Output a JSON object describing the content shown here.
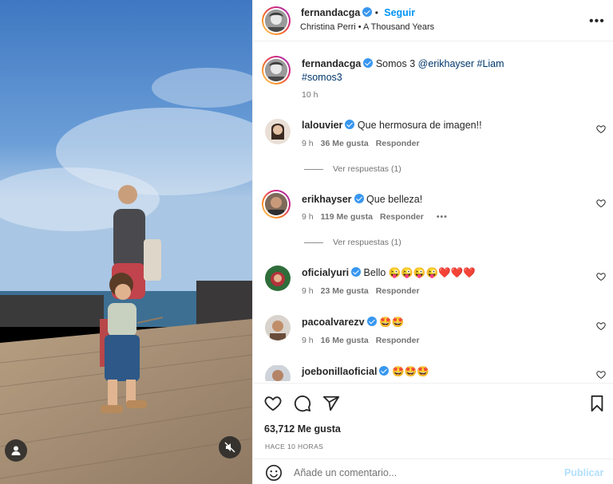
{
  "post": {
    "username": "fernandacga",
    "follow_label": "Seguir",
    "song": "Christina Perri • A Thousand Years",
    "caption_text": "Somos 3",
    "caption_mention": "@erikhayser",
    "caption_tag1": "#Liam",
    "caption_tag2": "#somos3",
    "caption_time": "10 h"
  },
  "comments": [
    {
      "user": "lalouvier",
      "text": "Que hermosura de imagen!!",
      "time": "9 h",
      "likes": "36 Me gusta",
      "reply": "Responder",
      "view_replies": "Ver respuestas (1)"
    },
    {
      "user": "erikhayser",
      "text": "Que belleza!",
      "time": "9 h",
      "likes": "119 Me gusta",
      "reply": "Responder",
      "view_replies": "Ver respuestas (1)"
    },
    {
      "user": "oficialyuri",
      "text": "Bello 😜😜😜😜❤️❤️❤️",
      "time": "9 h",
      "likes": "23 Me gusta",
      "reply": "Responder"
    },
    {
      "user": "pacoalvarezv",
      "text": "🤩🤩",
      "time": "9 h",
      "likes": "16 Me gusta",
      "reply": "Responder"
    },
    {
      "user": "joebonillaoficial",
      "text": "🤩🤩🤩"
    }
  ],
  "footer": {
    "likes": "63,712 Me gusta",
    "time": "HACE 10 HORAS",
    "comment_placeholder": "Añade un comentario...",
    "post_label": "Publicar"
  },
  "colors": {
    "link": "#00376b",
    "follow": "#0095f6",
    "verified": "#3897f0",
    "publish_disabled": "#b2dffc"
  },
  "icons": [
    "verified-badge-icon",
    "more-options-icon",
    "heart-icon",
    "comment-icon",
    "share-icon",
    "bookmark-icon",
    "emoji-icon",
    "tagged-users-icon",
    "mute-icon"
  ]
}
